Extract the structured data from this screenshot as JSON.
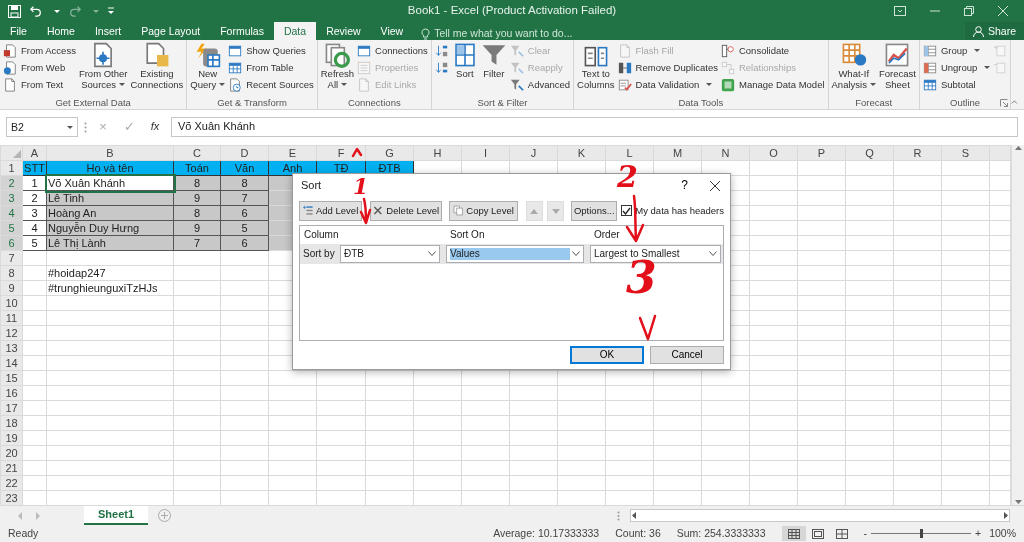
{
  "window": {
    "title": "Book1 - Excel (Product Activation Failed)"
  },
  "tabs": [
    {
      "label": "File",
      "selected": false
    },
    {
      "label": "Home",
      "selected": false
    },
    {
      "label": "Insert",
      "selected": false
    },
    {
      "label": "Page Layout",
      "selected": false
    },
    {
      "label": "Formulas",
      "selected": false
    },
    {
      "label": "Data",
      "selected": true
    },
    {
      "label": "Review",
      "selected": false
    },
    {
      "label": "View",
      "selected": false
    }
  ],
  "tell_me": {
    "placeholder": "Tell me what you want to do..."
  },
  "share": "Share",
  "ribbon": {
    "groups": [
      {
        "label": "Get External Data",
        "launcher": false,
        "columns": [
          {
            "kind": "stack",
            "items": [
              {
                "kind": "text",
                "label": "From Access",
                "disabled": false,
                "dropdown": false
              },
              {
                "kind": "text",
                "label": "From Web",
                "disabled": false,
                "dropdown": false
              },
              {
                "kind": "text",
                "label": "From Text",
                "disabled": false,
                "dropdown": false
              }
            ]
          },
          {
            "kind": "large",
            "lines": [
              "From Other",
              "Sources"
            ],
            "disabled": false,
            "dropdown": true
          },
          {
            "kind": "large",
            "lines": [
              "Existing",
              "Connections"
            ],
            "disabled": false,
            "dropdown": false
          }
        ]
      },
      {
        "label": "Get & Transform",
        "launcher": false,
        "columns": [
          {
            "kind": "large",
            "lines": [
              "New",
              "Query"
            ],
            "disabled": false,
            "dropdown": true
          },
          {
            "kind": "stack",
            "items": [
              {
                "kind": "text",
                "label": "Show Queries",
                "disabled": false,
                "dropdown": false
              },
              {
                "kind": "text",
                "label": "From Table",
                "disabled": false,
                "dropdown": false
              },
              {
                "kind": "text",
                "label": "Recent Sources",
                "disabled": false,
                "dropdown": false
              }
            ]
          }
        ]
      },
      {
        "label": "Connections",
        "launcher": false,
        "columns": [
          {
            "kind": "large",
            "lines": [
              "Refresh",
              "All"
            ],
            "disabled": false,
            "dropdown": true
          },
          {
            "kind": "stack",
            "items": [
              {
                "kind": "text",
                "label": "Connections",
                "disabled": false,
                "dropdown": false
              },
              {
                "kind": "text",
                "label": "Properties",
                "disabled": true,
                "dropdown": false
              },
              {
                "kind": "text",
                "label": "Edit Links",
                "disabled": true,
                "dropdown": false
              }
            ]
          }
        ]
      },
      {
        "label": "Sort & Filter",
        "launcher": false,
        "columns": [
          {
            "kind": "stack",
            "items": [
              {
                "kind": "icon",
                "disabled": false,
                "dropdown": false
              },
              {
                "kind": "icon",
                "disabled": false,
                "dropdown": false
              }
            ]
          },
          {
            "kind": "large",
            "lines": [
              "Sort"
            ],
            "disabled": false,
            "dropdown": false
          },
          {
            "kind": "large",
            "lines": [
              "Filter"
            ],
            "disabled": false,
            "dropdown": false
          },
          {
            "kind": "stack",
            "items": [
              {
                "kind": "text",
                "label": "Clear",
                "disabled": true,
                "dropdown": false
              },
              {
                "kind": "text",
                "label": "Reapply",
                "disabled": true,
                "dropdown": false
              },
              {
                "kind": "text",
                "label": "Advanced",
                "disabled": false,
                "dropdown": false
              }
            ]
          }
        ]
      },
      {
        "label": "Data Tools",
        "launcher": false,
        "columns": [
          {
            "kind": "large",
            "lines": [
              "Text to",
              "Columns"
            ],
            "disabled": false,
            "dropdown": false
          },
          {
            "kind": "stack",
            "items": [
              {
                "kind": "text",
                "label": "Flash Fill",
                "disabled": true,
                "dropdown": false
              },
              {
                "kind": "text",
                "label": "Remove Duplicates",
                "disabled": false,
                "dropdown": false
              },
              {
                "kind": "text",
                "label": "Data Validation",
                "disabled": false,
                "dropdown": true
              }
            ]
          },
          {
            "kind": "stack",
            "items": [
              {
                "kind": "text",
                "label": "Consolidate",
                "disabled": false,
                "dropdown": false
              },
              {
                "kind": "text",
                "label": "Relationships",
                "disabled": true,
                "dropdown": false
              },
              {
                "kind": "text",
                "label": "Manage Data Model",
                "disabled": false,
                "dropdown": false
              }
            ]
          }
        ]
      },
      {
        "label": "Forecast",
        "launcher": false,
        "columns": [
          {
            "kind": "large",
            "lines": [
              "What-If",
              "Analysis"
            ],
            "disabled": false,
            "dropdown": true
          },
          {
            "kind": "large",
            "lines": [
              "Forecast",
              "Sheet"
            ],
            "disabled": false,
            "dropdown": false
          }
        ]
      },
      {
        "label": "Outline",
        "launcher": true,
        "columns": [
          {
            "kind": "stack",
            "items": [
              {
                "kind": "text",
                "label": "Group",
                "disabled": false,
                "dropdown": true
              },
              {
                "kind": "text",
                "label": "Ungroup",
                "disabled": false,
                "dropdown": true
              },
              {
                "kind": "text",
                "label": "Subtotal",
                "disabled": false,
                "dropdown": false
              }
            ]
          },
          {
            "kind": "stack",
            "items": [
              {
                "kind": "icon",
                "disabled": true,
                "dropdown": false
              },
              {
                "kind": "icon",
                "disabled": true,
                "dropdown": false
              }
            ]
          }
        ]
      }
    ]
  },
  "formula_bar": {
    "name_box": "B2",
    "buttons": [
      {
        "label": "×",
        "disabled": true
      },
      {
        "label": "✓",
        "disabled": true
      },
      {
        "label": "fx",
        "disabled": false
      }
    ],
    "value": "Võ Xuân Khánh"
  },
  "sheet": {
    "columns": [
      "A",
      "B",
      "C",
      "D",
      "E",
      "F",
      "G",
      "H",
      "I",
      "J",
      "K",
      "L",
      "M",
      "N",
      "O",
      "P",
      "Q",
      "R",
      "S"
    ],
    "row_numbers": [
      "1",
      "2",
      "3",
      "4",
      "5",
      "6",
      "7",
      "8",
      "9",
      "10",
      "11",
      "12",
      "13",
      "14",
      "15",
      "16",
      "17",
      "18",
      "19",
      "20",
      "21",
      "22",
      "23"
    ],
    "table": {
      "header": [
        "STT",
        "Họ và tên",
        "Toán",
        "Văn",
        "Anh",
        "TĐ",
        "ĐTB"
      ],
      "rows": [
        {
          "highlighted": true,
          "cells": [
            {
              "text": "1",
              "active": false
            },
            {
              "text": "Võ Xuân Khánh",
              "active": true
            },
            {
              "text": "8",
              "active": false
            },
            {
              "text": "8",
              "active": false
            }
          ]
        },
        {
          "highlighted": true,
          "cells": [
            {
              "text": "2",
              "active": false
            },
            {
              "text": "Lê Tinh",
              "active": false
            },
            {
              "text": "9",
              "active": false
            },
            {
              "text": "7",
              "active": false
            }
          ]
        },
        {
          "highlighted": true,
          "cells": [
            {
              "text": "3",
              "active": false
            },
            {
              "text": "Hoàng An",
              "active": false
            },
            {
              "text": "8",
              "active": false
            },
            {
              "text": "6",
              "active": false
            }
          ]
        },
        {
          "highlighted": true,
          "cells": [
            {
              "text": "4",
              "active": false
            },
            {
              "text": "Nguyễn Duy Hưng",
              "active": false
            },
            {
              "text": "9",
              "active": false
            },
            {
              "text": "5",
              "active": false
            }
          ]
        },
        {
          "highlighted": true,
          "cells": [
            {
              "text": "5",
              "active": false
            },
            {
              "text": "Lê Thị Lành",
              "active": false
            },
            {
              "text": "7",
              "active": false
            },
            {
              "text": "6",
              "active": false
            }
          ]
        }
      ]
    },
    "notes": [
      {
        "text": "#hoidap247"
      },
      {
        "text": "#trunghieunguxiTzHJs"
      }
    ]
  },
  "sort_dialog": {
    "title": "Sort",
    "help": "?",
    "toolbar": [
      {
        "kind": "button",
        "label": "Add Level",
        "disabled": false
      },
      {
        "kind": "button",
        "label": "Delete Level",
        "disabled": false
      },
      {
        "kind": "button",
        "label": "Copy Level",
        "disabled": false
      },
      {
        "kind": "up",
        "disabled": true
      },
      {
        "kind": "down",
        "disabled": true
      },
      {
        "kind": "button",
        "label": "Options...",
        "disabled": false
      }
    ],
    "headers_checkbox": {
      "label": "My data has headers",
      "checked": true
    },
    "columns": [
      "Column",
      "Sort On",
      "Order"
    ],
    "levels": [
      {
        "label": "Sort by",
        "fields": [
          {
            "value": "ĐTB",
            "focused": false
          },
          {
            "value": "Values",
            "focused": true
          },
          {
            "value": "Largest to Smallest",
            "focused": false
          }
        ]
      }
    ],
    "buttons": [
      {
        "label": "OK",
        "default": true
      },
      {
        "label": "Cancel",
        "default": false
      }
    ]
  },
  "annotations": [
    {
      "text": "1"
    },
    {
      "text": "2"
    },
    {
      "text": "3"
    }
  ],
  "sheet_tabs": [
    {
      "label": "Sheet1",
      "selected": true
    }
  ],
  "status_bar": {
    "status": "Ready",
    "stats": [
      "Average: 10.17333333",
      "Count: 36",
      "Sum: 254.3333333"
    ],
    "views": [
      {
        "selected": true
      },
      {
        "selected": false
      },
      {
        "selected": false
      }
    ],
    "zoom": {
      "minus": "-",
      "plus": "+",
      "level": 0.5,
      "reading": "100%"
    }
  }
}
